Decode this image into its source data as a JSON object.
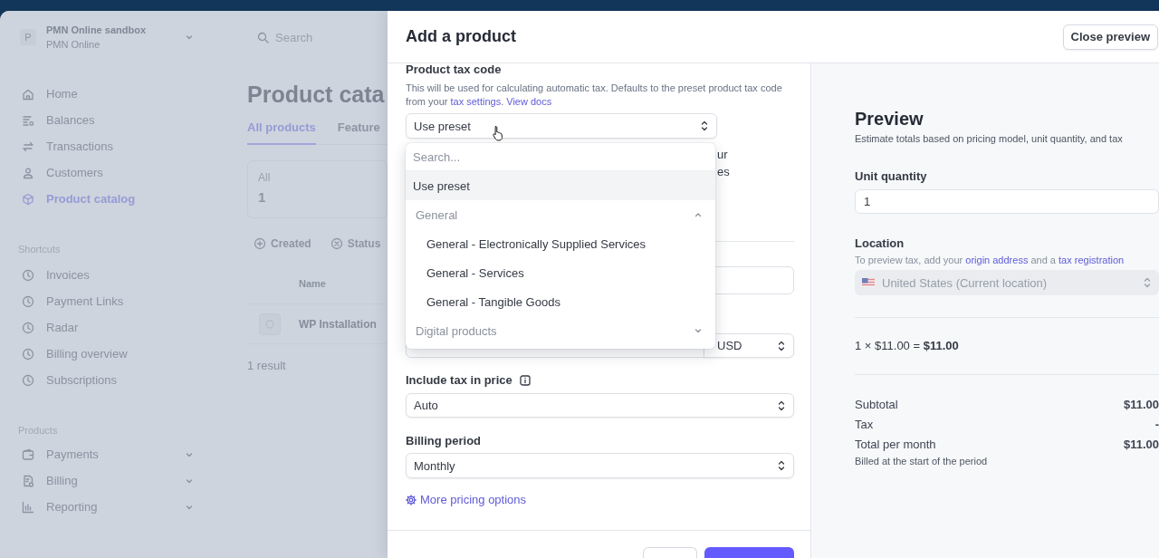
{
  "background_page": {
    "account": {
      "avatar": "P",
      "name": "PMN Online sandbox",
      "subtitle": "PMN Online"
    },
    "search": {
      "placeholder": "Search"
    },
    "nav": [
      {
        "label": "Home",
        "selected": false
      },
      {
        "label": "Balances",
        "selected": false
      },
      {
        "label": "Transactions",
        "selected": false
      },
      {
        "label": "Customers",
        "selected": false
      },
      {
        "label": "Product catalog",
        "selected": true
      }
    ],
    "shortcuts": {
      "title": "Shortcuts",
      "items": [
        {
          "label": "Invoices",
          "selected": false
        },
        {
          "label": "Payment Links",
          "selected": false
        },
        {
          "label": "Radar",
          "selected": false
        },
        {
          "label": "Billing overview",
          "selected": false
        },
        {
          "label": "Subscriptions",
          "selected": false
        }
      ]
    },
    "products": {
      "title": "Products",
      "items": [
        {
          "label": "Payments",
          "selected": false,
          "expanded": false
        },
        {
          "label": "Billing",
          "selected": false,
          "expanded": false
        },
        {
          "label": "Reporting",
          "selected": false,
          "expanded": false
        }
      ]
    },
    "title": "Product cata",
    "tabs": [
      {
        "label": "All products",
        "selected": true
      },
      {
        "label": "Feature",
        "selected": false
      }
    ],
    "summary": {
      "label": "All",
      "count": "1"
    },
    "filters": [
      {
        "label": "Created",
        "kind": "add"
      },
      {
        "label": "Status",
        "kind": "clear"
      }
    ],
    "table": {
      "columns": [
        "Name"
      ],
      "rows": [
        {
          "name": "WP Installation"
        }
      ]
    },
    "result_count": "1 result"
  },
  "modal": {
    "title": "Add a product",
    "close_preview": "Close preview",
    "tax_code": {
      "label": "Product tax code",
      "help": [
        {
          "text": "This will be used for calculating automatic tax. Defaults to the preset product tax code from your "
        },
        {
          "text": "tax settings",
          "kind": "link"
        },
        {
          "text": ". "
        },
        {
          "text": "View docs",
          "kind": "link"
        }
      ],
      "value": "Use preset",
      "dropdown": {
        "search_placeholder": "Search...",
        "options": [
          {
            "label": "Use preset",
            "kind": "option",
            "selected": true
          },
          {
            "label": "General",
            "kind": "group",
            "expanded": true,
            "children": [
              {
                "label": "General - Electronically Supplied Services",
                "selected": false
              },
              {
                "label": "General - Services",
                "selected": false
              },
              {
                "label": "General - Tangible Goods",
                "selected": false
              }
            ]
          },
          {
            "label": "Digital products",
            "kind": "group",
            "expanded": false
          }
        ]
      }
    },
    "obscured_text": [
      "ur",
      "es"
    ],
    "currency": "USD",
    "include_tax": {
      "label": "Include tax in price",
      "value": "Auto"
    },
    "billing_period": {
      "label": "Billing period",
      "value": "Monthly"
    },
    "more_options": "More pricing options",
    "footer_buttons": [
      {
        "kind": "secondary"
      },
      {
        "kind": "primary"
      }
    ],
    "preview": {
      "title": "Preview",
      "subtitle": "Estimate totals based on pricing model, unit quantity, and tax",
      "unit_quantity": {
        "label": "Unit quantity",
        "value": "1"
      },
      "location": {
        "label": "Location",
        "help": [
          {
            "text": "To preview tax, add your "
          },
          {
            "text": "origin address",
            "kind": "link"
          },
          {
            "text": " and a "
          },
          {
            "text": "tax registration",
            "kind": "link"
          }
        ],
        "value": "United States (Current location)",
        "disabled": true
      },
      "calculation": "1 × $11.00 = **$11.00**",
      "totals": [
        {
          "label": "Subtotal",
          "value": "$11.00"
        },
        {
          "label": "Tax",
          "value": "-"
        },
        {
          "label": "Total per month",
          "value": "$11.00",
          "note": "Billed at the start of the period"
        }
      ]
    }
  }
}
